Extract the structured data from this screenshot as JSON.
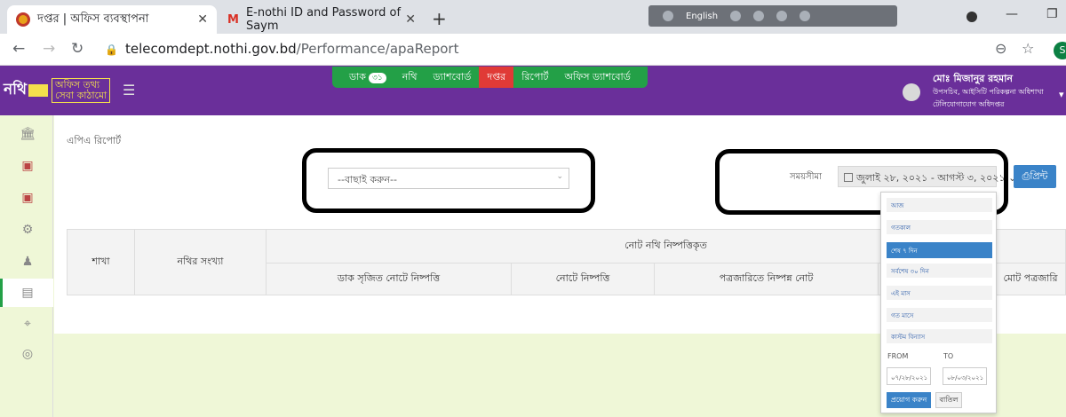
{
  "browser": {
    "tabs": [
      {
        "title": "দপ্তর | অফিস ব্যবস্থাপনা",
        "close": "✕"
      },
      {
        "title": "E-nothi ID and Password of Saym",
        "close": "✕"
      }
    ],
    "new_tab": "+",
    "language_bar": {
      "label": "English"
    },
    "window_controls": {
      "minimize": "—",
      "restore": "❐"
    },
    "nav": {
      "back": "←",
      "forward": "→",
      "reload": "↻"
    },
    "url": {
      "host": "telecomdept.nothi.gov.bd",
      "path": "/Performance/apaReport"
    },
    "zoom_icon": "⊖",
    "bookmark_icon": "☆",
    "profile_initial": "S"
  },
  "header": {
    "logo": {
      "brand": "নথি",
      "line1": "অফিস তথ্য",
      "line2": "সেবা কাঠামো"
    },
    "nav": [
      {
        "label": "ডাক",
        "badge": "৩১"
      },
      {
        "label": "নথি"
      },
      {
        "label": "ড্যাশবোর্ড"
      },
      {
        "label": "দপ্তর",
        "active": true
      },
      {
        "label": "রিপোর্ট"
      },
      {
        "label": "অফিস ড্যাশবোর্ড"
      }
    ],
    "user": {
      "name": "মোঃ মিজানুর রহমান",
      "designation": "উপসচিব, আইসিটি পরিকল্পনা অধিশাখা",
      "office": "টেলিযোগাযোগ অধিদপ্তর"
    }
  },
  "sidebar_icons": [
    "bank-icon",
    "briefcase-icon",
    "briefcase-icon",
    "gear-icon",
    "user-icon",
    "report-icon",
    "map-marker-icon",
    "help-icon"
  ],
  "page": {
    "title": "এপিএ রিপোর্ট",
    "select_placeholder": "--বাছাই করুন--",
    "date_label": "সময়সীমা",
    "date_range": "জুলাই ২৮, ২০২১ - আগস্ট ৩, ২০২১",
    "print_label": "প্রিন্ট"
  },
  "table": {
    "group_header": "নোট নথি নিষ্পত্তিকৃত",
    "columns": [
      "শাখা",
      "নথির সংখ্যা",
      "ডাক সৃজিত নোটে নিষ্পত্তি",
      "নোটে নিষ্পত্তি",
      "পত্রজারিতে নিষ্পন্ন নোট",
      "",
      "মোট পত্রজারি"
    ]
  },
  "date_dropdown": {
    "options": [
      "আজ",
      "গতকাল",
      "শেষ ৭ দিন",
      "সর্বশেষ ৩০ দিন",
      "এই মাস",
      "গত মাসে",
      "কাস্টম বিন্যাস"
    ],
    "selected_index": 2,
    "from_label": "FROM",
    "to_label": "TO",
    "from_value": "০৭/২৮/২০২১",
    "to_value": "০৮/০৩/২০২১",
    "apply_label": "প্রয়োগ করুন",
    "cancel_label": "বাতিল"
  }
}
